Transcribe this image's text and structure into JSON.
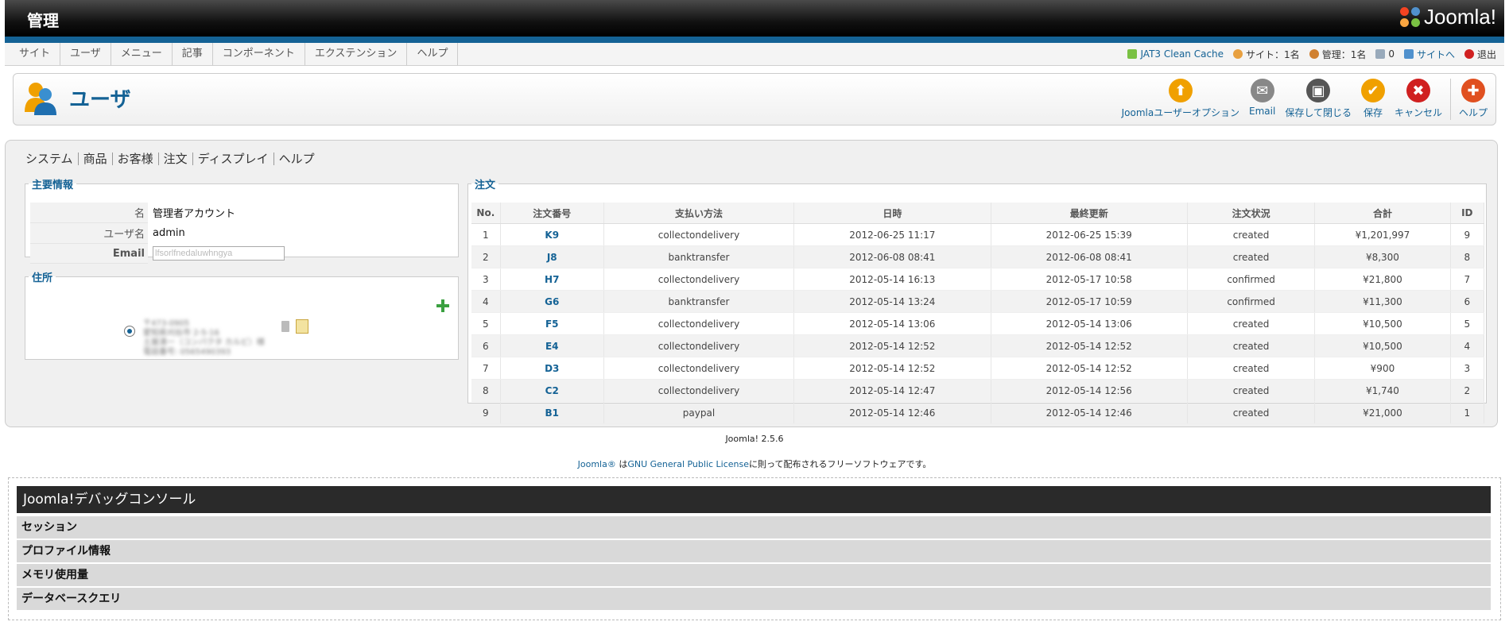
{
  "header": {
    "title": "管理",
    "logo_text": "Joomla!"
  },
  "menu": [
    "サイト",
    "ユーザ",
    "メニュー",
    "記事",
    "コンポーネント",
    "エクステンション",
    "ヘルプ"
  ],
  "status": {
    "cache": "JAT3 Clean Cache",
    "site_users": "サイト：1名",
    "admin_users": "管理：1名",
    "messages": "0",
    "site_link": "サイトへ",
    "logout": "退出"
  },
  "page": {
    "title": "ユーザ"
  },
  "toolbar": [
    {
      "name": "options",
      "label": "Joomlaユーザーオプション",
      "color": "#f0a000",
      "glyph": "⬆"
    },
    {
      "name": "email",
      "label": "Email",
      "color": "#888",
      "glyph": "✉"
    },
    {
      "name": "save-close",
      "label": "保存して閉じる",
      "color": "#555",
      "glyph": "▣"
    },
    {
      "name": "save",
      "label": "保存",
      "color": "#f0a000",
      "glyph": "✔"
    },
    {
      "name": "cancel",
      "label": "キャンセル",
      "color": "#d02020",
      "glyph": "✖"
    },
    {
      "name": "help",
      "label": "ヘルプ",
      "color": "#e05020",
      "glyph": "✚"
    }
  ],
  "subnav": [
    "システム",
    "商品",
    "お客様",
    "注文",
    "ディスプレイ",
    "ヘルプ"
  ],
  "main_info": {
    "legend": "主要情報",
    "rows": [
      {
        "key": "名",
        "value": "管理者アカウント"
      },
      {
        "key": "ユーザ名",
        "value": "admin"
      },
      {
        "key": "Email",
        "value": "lfsorlfnedaluwhngya"
      }
    ]
  },
  "address": {
    "legend": "住所",
    "lines": [
      "〒473-0905",
      "愛知県刈谷市 2-5-16",
      "土屋清一（コンパクタ カルビ）様",
      "電話番号: 0565490393"
    ]
  },
  "orders": {
    "legend": "注文",
    "columns": [
      "No.",
      "注文番号",
      "支払い方法",
      "日時",
      "最終更新",
      "注文状況",
      "合計",
      "ID"
    ],
    "rows": [
      [
        "1",
        "K9",
        "collectondelivery",
        "2012-06-25 11:17",
        "2012-06-25 15:39",
        "created",
        "¥1,201,997",
        "9"
      ],
      [
        "2",
        "J8",
        "banktransfer",
        "2012-06-08 08:41",
        "2012-06-08 08:41",
        "created",
        "¥8,300",
        "8"
      ],
      [
        "3",
        "H7",
        "collectondelivery",
        "2012-05-14 16:13",
        "2012-05-17 10:58",
        "confirmed",
        "¥21,800",
        "7"
      ],
      [
        "4",
        "G6",
        "banktransfer",
        "2012-05-14 13:24",
        "2012-05-17 10:59",
        "confirmed",
        "¥11,300",
        "6"
      ],
      [
        "5",
        "F5",
        "collectondelivery",
        "2012-05-14 13:06",
        "2012-05-14 13:06",
        "created",
        "¥10,500",
        "5"
      ],
      [
        "6",
        "E4",
        "collectondelivery",
        "2012-05-14 12:52",
        "2012-05-14 12:52",
        "created",
        "¥10,500",
        "4"
      ],
      [
        "7",
        "D3",
        "collectondelivery",
        "2012-05-14 12:52",
        "2012-05-14 12:52",
        "created",
        "¥900",
        "3"
      ],
      [
        "8",
        "C2",
        "collectondelivery",
        "2012-05-14 12:47",
        "2012-05-14 12:56",
        "created",
        "¥1,740",
        "2"
      ],
      [
        "9",
        "B1",
        "paypal",
        "2012-05-14 12:46",
        "2012-05-14 12:46",
        "created",
        "¥21,000",
        "1"
      ]
    ]
  },
  "footer": {
    "version": "Joomla! 2.5.6",
    "license_prefix": "Joomla®",
    "license_mid": " は",
    "license_link": "GNU General Public License",
    "license_suffix": "に則って配布されるフリーソフトウェアです。"
  },
  "debug": {
    "title": "Joomla!デバッグコンソール",
    "rows": [
      "セッション",
      "プロファイル情報",
      "メモリ使用量",
      "データベースクエリ"
    ]
  }
}
